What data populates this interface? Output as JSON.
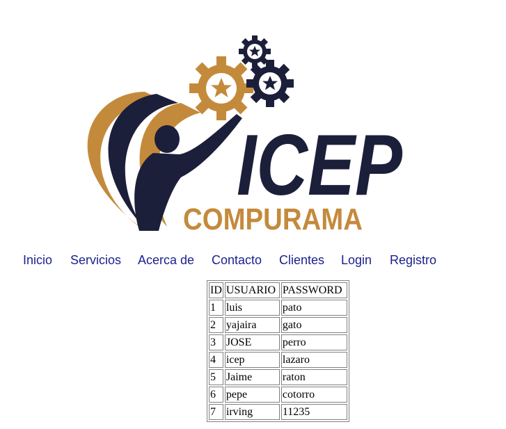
{
  "logo": {
    "title": "ICEP",
    "subtitle": "COMPURAMA",
    "colors": {
      "navy": "#1c1f3a",
      "gold": "#c48a3c"
    }
  },
  "nav": {
    "items": [
      "Inicio",
      "Servicios",
      "Acerca de",
      "Contacto",
      "Clientes",
      "Login",
      "Registro"
    ],
    "color": "#1a1f8c"
  },
  "users_table": {
    "headers": [
      "ID",
      "USUARIO",
      "PASSWORD"
    ],
    "rows": [
      [
        "1",
        "luis",
        "pato"
      ],
      [
        "2",
        "yajaira",
        "gato"
      ],
      [
        "3",
        "JOSE",
        "perro"
      ],
      [
        "4",
        "icep",
        "lazaro"
      ],
      [
        "5",
        "Jaime",
        "raton"
      ],
      [
        "6",
        "pepe",
        "cotorro"
      ],
      [
        "7",
        "irving",
        "11235"
      ]
    ]
  }
}
